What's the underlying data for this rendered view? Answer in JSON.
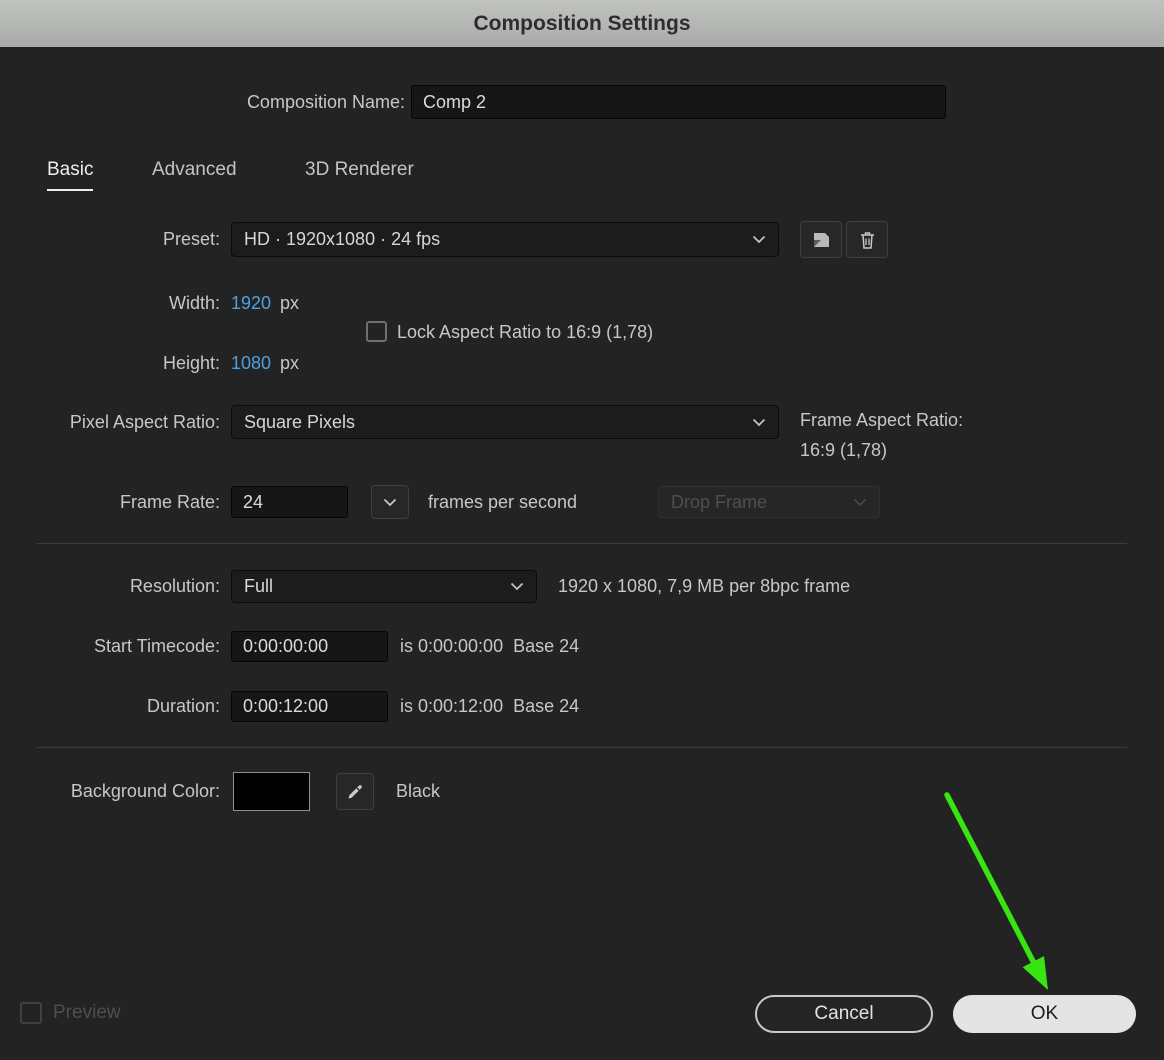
{
  "title": "Composition Settings",
  "composition_name": {
    "label": "Composition Name:",
    "value": "Comp 2"
  },
  "tabs": [
    {
      "label": "Basic"
    },
    {
      "label": "Advanced"
    },
    {
      "label": "3D Renderer"
    }
  ],
  "preset": {
    "label": "Preset:",
    "value": "HD · 1920x1080 · 24 fps"
  },
  "dimensions": {
    "width_label": "Width:",
    "width_value": "1920",
    "width_unit": "px",
    "height_label": "Height:",
    "height_value": "1080",
    "height_unit": "px",
    "lock_label": "Lock Aspect Ratio to 16:9 (1,78)",
    "lock_checked": false
  },
  "pixel_aspect_ratio": {
    "label": "Pixel Aspect Ratio:",
    "value": "Square Pixels"
  },
  "frame_aspect_ratio": {
    "label": "Frame Aspect Ratio:",
    "value": "16:9 (1,78)"
  },
  "frame_rate": {
    "label": "Frame Rate:",
    "value": "24",
    "suffix": "frames per second",
    "drop_frame_label": "Drop Frame"
  },
  "resolution": {
    "label": "Resolution:",
    "value": "Full",
    "info": "1920 x 1080, 7,9 MB per 8bpc frame"
  },
  "start_timecode": {
    "label": "Start Timecode:",
    "value": "0:00:00:00",
    "info": "is 0:00:00:00  Base 24"
  },
  "duration": {
    "label": "Duration:",
    "value": "0:00:12:00",
    "info": "is 0:00:12:00  Base 24"
  },
  "background_color": {
    "label": "Background Color:",
    "color_name": "Black",
    "swatch_hex": "#000000"
  },
  "footer": {
    "preview_label": "Preview",
    "cancel_label": "Cancel",
    "ok_label": "OK"
  },
  "annotation": {
    "arrow_color": "#38e411"
  }
}
